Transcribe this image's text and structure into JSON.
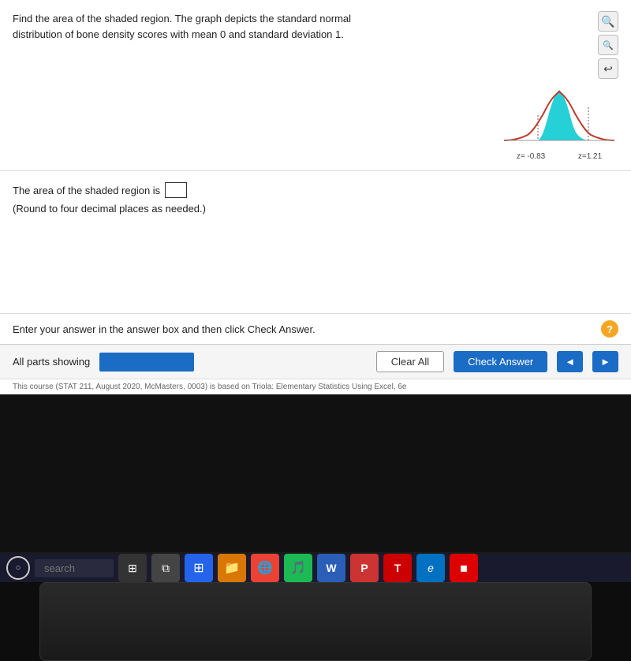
{
  "question": {
    "text_line1": "Find the area of the shaded region. The graph depicts the standard normal",
    "text_line2": "distribution of bone density scores with mean 0 and standard deviation 1.",
    "graph": {
      "z_left_label": "z= -0.83",
      "z_right_label": "z=1.21"
    }
  },
  "answer": {
    "prefix": "The area of the shaded region is",
    "round_note": "(Round to four decimal places as needed.)"
  },
  "instruction": {
    "text": "Enter your answer in the answer box and then click Check Answer."
  },
  "action_bar": {
    "all_parts_label": "All parts showing",
    "clear_all_label": "Clear All",
    "check_answer_label": "Check Answer",
    "nav_prev": "◄",
    "nav_next": "►"
  },
  "citation": {
    "text": "This course (STAT 211, August 2020, McMasters, 0003) is based on Triola: Elementary Statistics Using Excel, 6e"
  },
  "taskbar": {
    "search_placeholder": "search",
    "icons": [
      "⊞",
      "🗔",
      "⊞",
      "📁",
      "🌐",
      "🎵",
      "W",
      "P",
      "T",
      "e"
    ]
  },
  "help_icon": "?",
  "graph_controls": {
    "zoom_in": "🔍",
    "zoom_out": "🔍",
    "reset": "↩"
  }
}
